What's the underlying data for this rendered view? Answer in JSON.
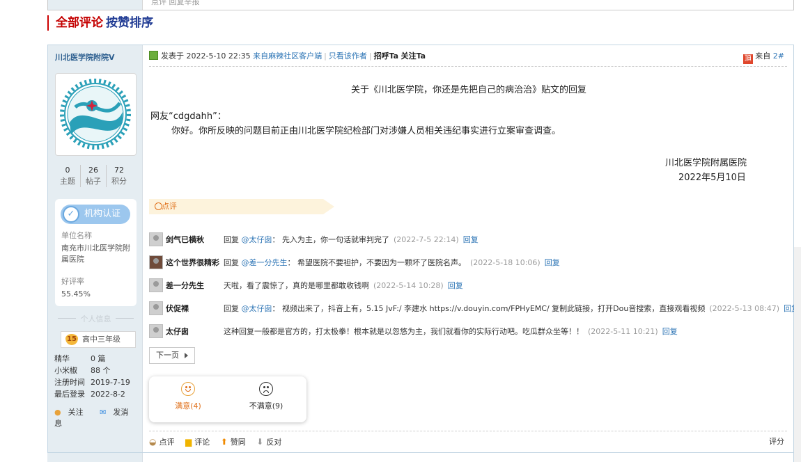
{
  "previous_post": {
    "snippet": "点评  回复举报"
  },
  "sort_header": {
    "all_comments": "全部评论",
    "sort_by_like": "按赞排序"
  },
  "author": {
    "name": "川北医学院附院",
    "verified_mark": "V",
    "stats": [
      {
        "value": "0",
        "label": "主题"
      },
      {
        "value": "26",
        "label": "帖子"
      },
      {
        "value": "72",
        "label": "积分"
      }
    ],
    "certification": {
      "badge_label": "机构认证",
      "unit_key": "单位名称",
      "unit_value": "南充市川北医学院附属医院",
      "rating_key": "好评率",
      "rating_value": "55.45%"
    },
    "personal_info_label": "个人信息",
    "level": {
      "number": "15",
      "title": "高中三年级"
    },
    "info": [
      {
        "key": "精华",
        "value": "0 篇"
      },
      {
        "key": "小米椒",
        "value": "88 个"
      },
      {
        "key": "注册时间",
        "value": "2019-7-19"
      },
      {
        "key": "最后登录",
        "value": "2022-8-2"
      }
    ],
    "actions": {
      "follow": "关注",
      "message": "发消息"
    }
  },
  "post": {
    "meta": {
      "posted_at": "发表于 2022-5-10 22:35",
      "client": "来自麻辣社区客户端",
      "only_author": "只看该作者",
      "greet": "招呼Ta",
      "follow": "关注Ta",
      "from_label": "来自",
      "floor": "2#"
    },
    "reply_title": "关于《川北医学院，你还是先把自己的病治治》贴文的回复",
    "greeting": "网友“cdgdahh”：",
    "body": "你好。你所反映的问题目前正由川北医学院纪检部门对涉嫌人员相关违纪事实进行立案审查调查。",
    "signature_org": "川北医学院附属医院",
    "signature_date": "2022年5月10日",
    "comment_tag": "点评",
    "comments": [
      {
        "user": "剑气已横秋",
        "reply_prefix": "回复 ",
        "at": "@太仔囱",
        "text": "： 先入为主，你一句话就审判完了",
        "time": "(2022-7-5 22:14)",
        "reply": "回复"
      },
      {
        "user": "这个世界很精彩",
        "reply_prefix": "回复 ",
        "at": "@差一分先生",
        "text": "： 希望医院不要袒护，不要因为一颗坏了医院名声。",
        "time": "(2022-5-18 10:06)",
        "reply": "回复"
      },
      {
        "user": "差一分先生",
        "reply_prefix": "",
        "at": "",
        "text": "天啦，看了震惊了，真的是哪里都敢收钱啊",
        "time": "(2022-5-14 10:28)",
        "reply": "回复"
      },
      {
        "user": "伏促裸",
        "reply_prefix": "回复 ",
        "at": "@太仔囱",
        "text": "： 视频出来了，抖音上有，5.15 JvF:/ 李建水  https://v.douyin.com/FPHyEMC/ 复制此链接，打开Dou音搜索，直接观看视频",
        "time": "(2022-5-13 08:47)",
        "reply": "回复"
      },
      {
        "user": "太仔囱",
        "reply_prefix": "",
        "at": "",
        "text": "这种回复一般都是官方的，打太极拳！根本就是以忽悠为主，我们就看你的实际行动吧。吃瓜群众坐等！！",
        "time": "(2022-5-11 10:21)",
        "reply": "回复"
      }
    ],
    "next_page": "下一页",
    "votes": {
      "satisfied": "满意(4)",
      "unsatisfied": "不满意(9)"
    },
    "footer": {
      "comment": "点评",
      "review": "评论",
      "like": "赞同",
      "oppose": "反对",
      "rate": "评分"
    }
  },
  "colors": {
    "accent_red": "#c40000",
    "accent_navy": "#1f3a93",
    "link_blue": "#2c74b5",
    "sidebar_bg": "#e5edf2",
    "comment_orange": "#e0701a"
  }
}
